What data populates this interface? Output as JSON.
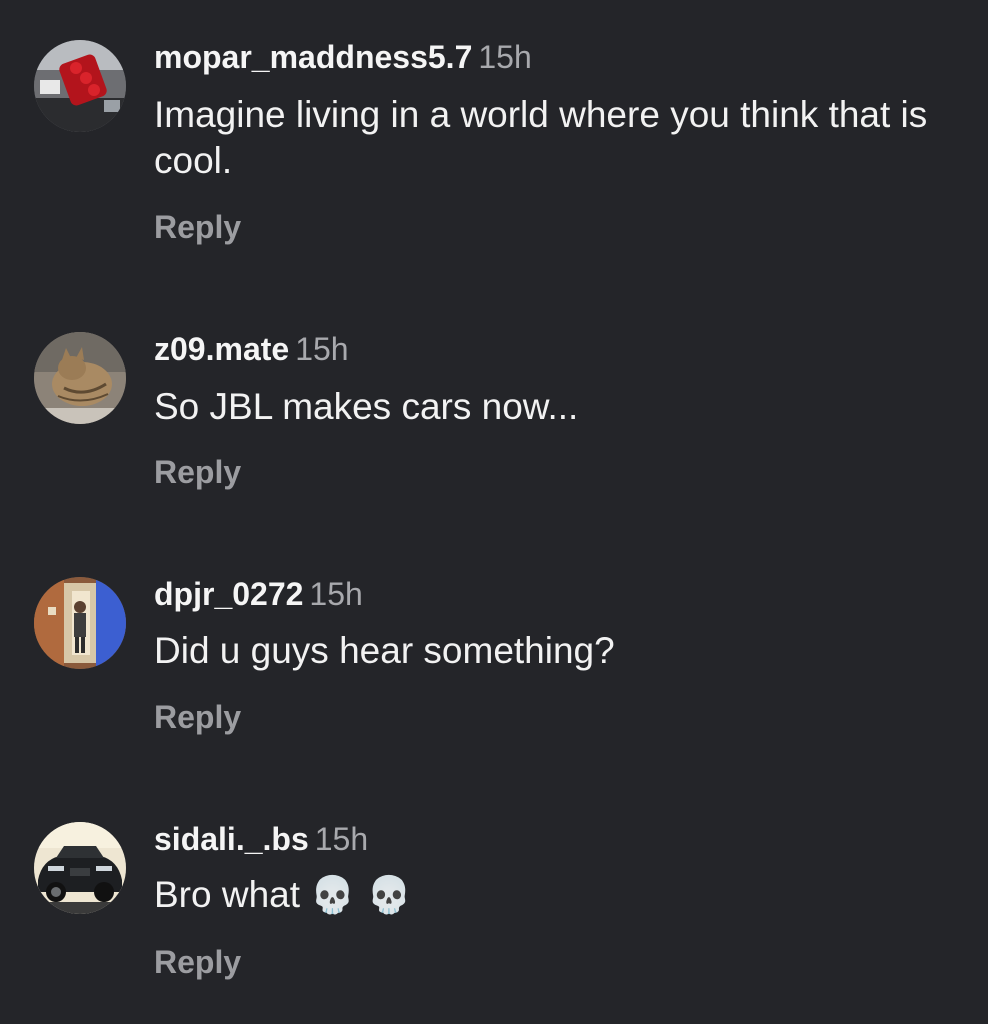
{
  "comments": [
    {
      "username": "mopar_maddness5.7",
      "time": "15h",
      "text": "Imagine living in a world where you think that is cool.",
      "reply_label": "Reply",
      "avatar_icon": "engine-photo-avatar"
    },
    {
      "username": "z09.mate",
      "time": "15h",
      "text": "So JBL makes cars now...",
      "reply_label": "Reply",
      "avatar_icon": "cat-photo-avatar"
    },
    {
      "username": "dpjr_0272",
      "time": "15h",
      "text": "Did u guys hear something?",
      "reply_label": "Reply",
      "avatar_icon": "mirror-selfie-avatar"
    },
    {
      "username": "sidali._.bs",
      "time": "15h",
      "text": "Bro what",
      "emoji": "💀 💀",
      "reply_label": "Reply",
      "avatar_icon": "car-photo-avatar"
    }
  ],
  "colors": {
    "background": "#242529",
    "primary_text": "#f5f5f5",
    "secondary_text": "#a8a9ad",
    "reply_text": "#9c9da1"
  }
}
